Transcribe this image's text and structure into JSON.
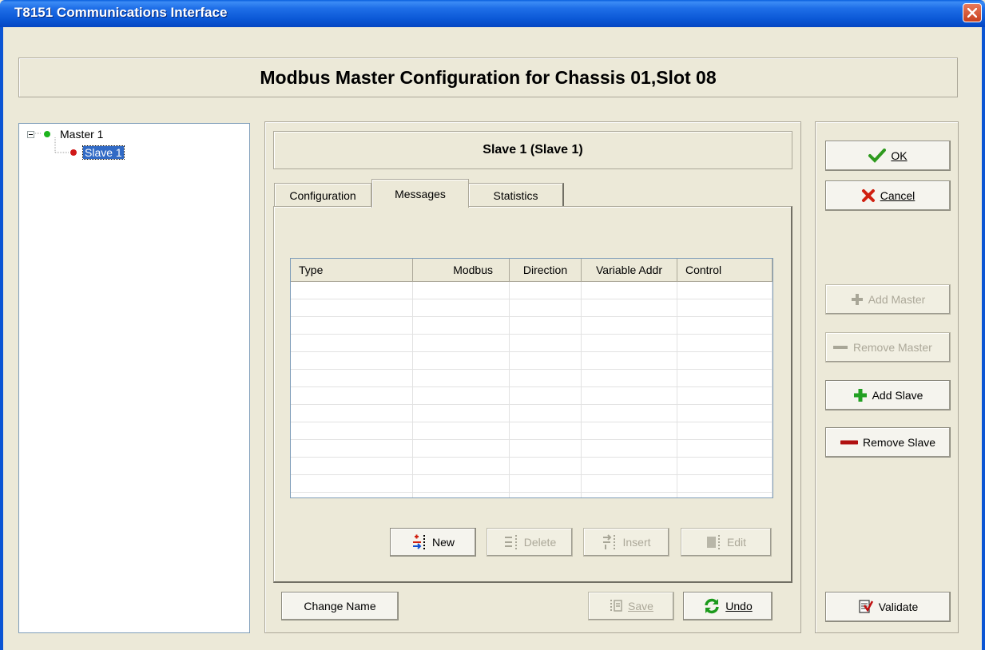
{
  "window": {
    "title": "T8151 Communications Interface"
  },
  "header": {
    "title": "Modbus Master Configuration for Chassis 01,Slot 08"
  },
  "tree": {
    "items": [
      {
        "label": "Master 1",
        "color": "#1DB41D"
      },
      {
        "label": "Slave 1",
        "color": "#D01818"
      }
    ]
  },
  "slave_panel": {
    "title": "Slave 1 (Slave 1)",
    "tabs": [
      {
        "label": "Configuration"
      },
      {
        "label": "Messages"
      },
      {
        "label": "Statistics"
      }
    ],
    "table": {
      "columns": [
        "Type",
        "Modbus",
        "Direction",
        "Variable Addr",
        "Control"
      ],
      "rows": []
    },
    "buttons": {
      "new": "New",
      "delete": "Delete",
      "insert": "Insert",
      "edit": "Edit"
    }
  },
  "bottom": {
    "change_name": "Change Name",
    "save": "Save",
    "undo": "Undo"
  },
  "side": {
    "ok": "OK",
    "cancel": "Cancel",
    "add_master": "Add Master",
    "remove_master": "Remove Master",
    "add_slave": "Add Slave",
    "remove_slave": "Remove Slave",
    "validate": "Validate"
  },
  "colors": {
    "titlebar": "#0B58D6",
    "selection": "#316AC5",
    "ok_check": "#2E9A1E",
    "cancel_x": "#D02010"
  }
}
